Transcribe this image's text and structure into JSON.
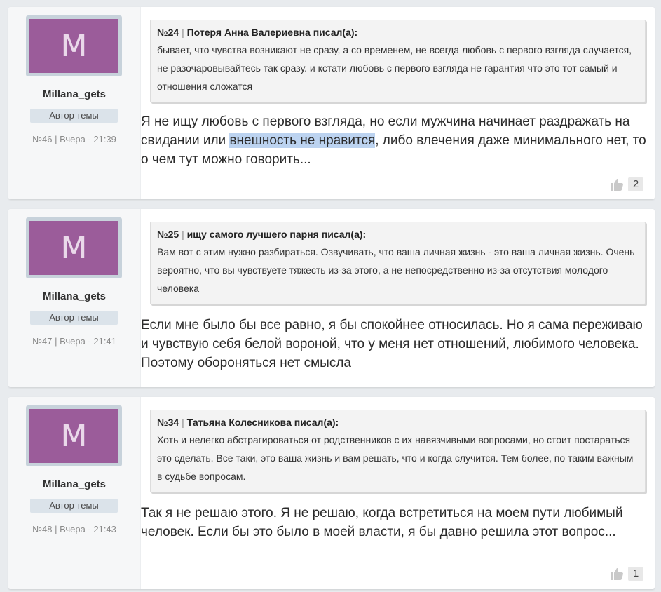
{
  "posts": [
    {
      "avatar_letter": "M",
      "username": "Millana_gets",
      "badge": "Автор темы",
      "meta": "№46 | Вчера - 21:39",
      "quote": {
        "ref": "№24",
        "author": "Потеря Анна Валериевна писал(а):",
        "text": "бывает, что чувства возникают не сразу, а со временем, не всегда любовь с первого взгляда случается, не разочаровывайтесь так сразу. и кстати любовь с первого взгляда не гарантия что это тот самый и отношения сложатся"
      },
      "text_before": "Я не ищу любовь с первого взгляда, но если мужчина начинает раздражать на свидании или ",
      "text_highlight": "внешность не нравится",
      "text_after": ", либо влечения даже минимального нет, то о чем тут можно говорить...",
      "likes": "2"
    },
    {
      "avatar_letter": "M",
      "username": "Millana_gets",
      "badge": "Автор темы",
      "meta": "№47 | Вчера - 21:41",
      "quote": {
        "ref": "№25",
        "author": "ищу самого лучшего парня писал(а):",
        "text": "Вам вот с этим нужно разбираться. Озвучивать, что ваша личная жизнь - это ваша личная жизнь. Очень вероятно, что вы чувствуете тяжесть из-за этого, а не непосредственно из-за отсутствия молодого человека"
      },
      "text": "Если мне было бы все равно, я бы спокойнее относилась. Но я сама переживаю и чувствую себя белой вороной, что у меня нет отношений, любимого человека. Поэтому обороняться нет смысла"
    },
    {
      "avatar_letter": "M",
      "username": "Millana_gets",
      "badge": "Автор темы",
      "meta": "№48 | Вчера - 21:43",
      "quote": {
        "ref": "№34",
        "author": "Татьяна Колесникова писал(а):",
        "text": "Хоть и нелегко абстрагироваться от родственников с их навязчивыми вопросами, но стоит постараться это сделать. Все таки, это ваша жизнь и вам решать, что и когда случится. Тем более, по таким важным в судьбе вопросам."
      },
      "text": "Так я не решаю этого. Я не решаю, когда встретиться на моем пути любимый человек. Если бы это было в моей власти, я бы давно решила этот вопрос...",
      "likes": "1"
    }
  ],
  "icons": {
    "like": "thumbs-up-icon"
  },
  "colors": {
    "avatar_bg": "#9b5c9a",
    "highlight": "#bcd3f0",
    "badge_bg": "#dbe3ea"
  }
}
